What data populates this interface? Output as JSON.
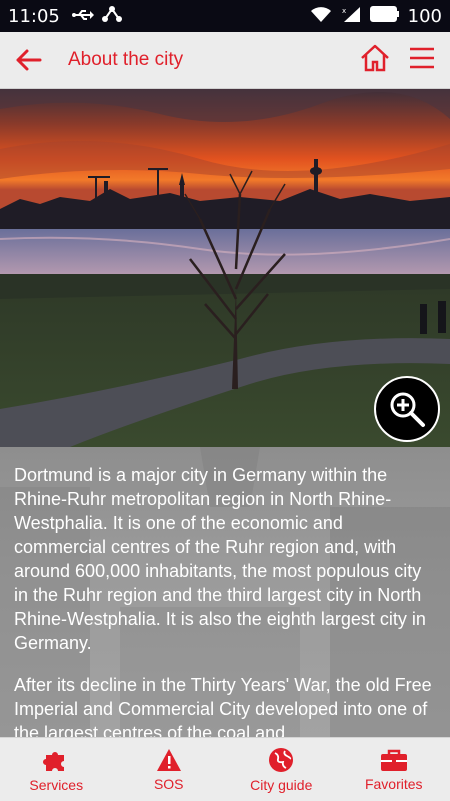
{
  "status_bar": {
    "time": "11:05",
    "battery_level": "100"
  },
  "app_bar": {
    "title": "About the city"
  },
  "hero": {
    "zoom_icon": "zoom-in-icon"
  },
  "content": {
    "paragraphs": [
      "Dortmund is a major city in Germany within the Rhine-Ruhr metropolitan region in North Rhine-Westphalia. It is one of the economic and commercial centres of the Ruhr region and, with around 600,000 inhabitants, the most populous city in the Ruhr region and the third largest city in North Rhine-Westphalia. It is also the eighth largest city in Germany.",
      "After its decline in the Thirty Years' War, the old Free Imperial and Commercial City developed into one of the largest centres of the coal and"
    ]
  },
  "bottom_nav": {
    "items": [
      {
        "label": "Services",
        "icon": "puzzle-icon"
      },
      {
        "label": "SOS",
        "icon": "warning-icon"
      },
      {
        "label": "City guide",
        "icon": "globe-icon"
      },
      {
        "label": "Favorites",
        "icon": "briefcase-icon"
      }
    ]
  },
  "colors": {
    "accent": "#e0202b",
    "statusbar": "#0a0a14",
    "appbar": "#ececec"
  }
}
